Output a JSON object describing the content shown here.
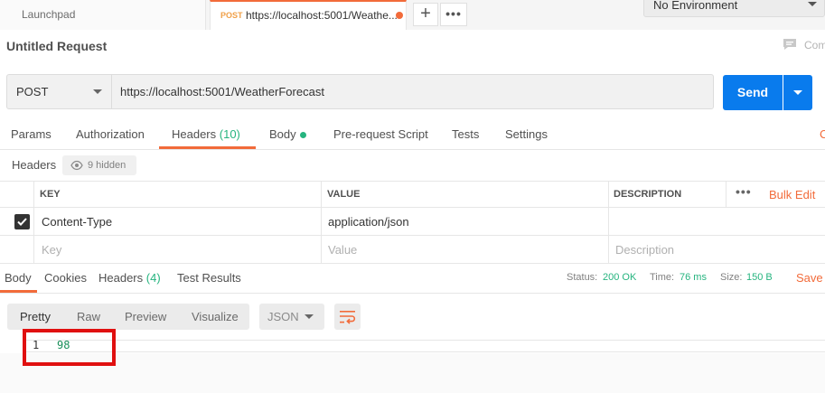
{
  "tabs": {
    "launchpad": "Launchpad",
    "active": {
      "method": "POST",
      "title": "https://localhost:5001/Weathe..."
    },
    "plus": "+",
    "more": "•••"
  },
  "environment": "No Environment",
  "request": {
    "title": "Untitled Request",
    "comments_label": "Com",
    "method": "POST",
    "url": "https://localhost:5001/WeatherForecast",
    "send_label": "Send"
  },
  "request_tabs": [
    {
      "label": "Params"
    },
    {
      "label": "Authorization"
    },
    {
      "label": "Headers",
      "count": "(10)"
    },
    {
      "label": "Body"
    },
    {
      "label": "Pre-request Script"
    },
    {
      "label": "Tests"
    },
    {
      "label": "Settings"
    }
  ],
  "cookies_edge": "C",
  "headers_section": {
    "label": "Headers",
    "hidden": "9 hidden",
    "columns": {
      "key": "KEY",
      "value": "VALUE",
      "description": "DESCRIPTION"
    },
    "more": "•••",
    "bulk_edit": "Bulk Edit",
    "rows": [
      {
        "key": "Content-Type",
        "value": "application/json",
        "description": "",
        "checked": true
      }
    ],
    "placeholders": {
      "key": "Key",
      "value": "Value",
      "description": "Description"
    }
  },
  "response_tabs": [
    {
      "label": "Body"
    },
    {
      "label": "Cookies"
    },
    {
      "label": "Headers",
      "count": "(4)"
    },
    {
      "label": "Test Results"
    }
  ],
  "response_meta": {
    "status_label": "Status:",
    "status": "200 OK",
    "time_label": "Time:",
    "time": "76 ms",
    "size_label": "Size:",
    "size": "150 B",
    "save_label": "Save R"
  },
  "format_tabs": [
    "Pretty",
    "Raw",
    "Preview",
    "Visualize"
  ],
  "format_select": "JSON",
  "response_body": [
    {
      "line": "1",
      "value": "98"
    }
  ],
  "colors": {
    "accent": "#f26b3a",
    "primary": "#097bed",
    "success": "#26b47f",
    "highlight": "#e01010"
  }
}
